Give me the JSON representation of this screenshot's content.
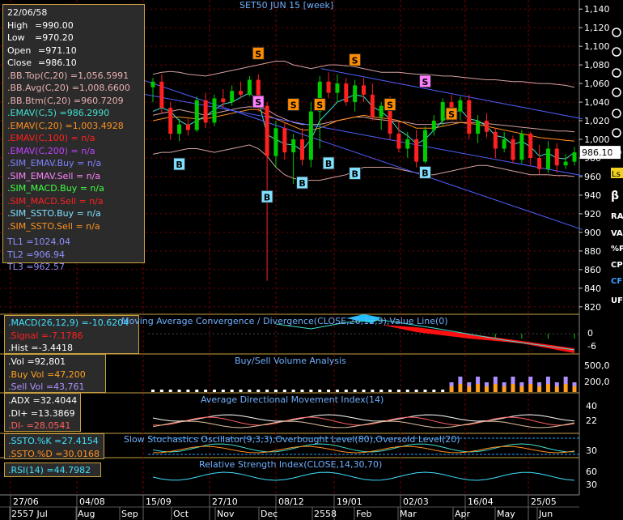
{
  "chart_data": {
    "type": "candlestick",
    "title": "SET50 JUN 15  [week]",
    "x_tick_labels": [
      "27/06",
      "04/08",
      "15/09",
      "27/10",
      "08/12",
      "19/01",
      "02/03",
      "16/04",
      "25/05"
    ],
    "month_labels": [
      "2557 Jul",
      "Aug",
      "Sep",
      "Oct",
      "Nov",
      "Dec",
      "2558",
      "Feb",
      "Mar",
      "Apr",
      "May",
      "Jun"
    ],
    "y_tick_labels": [
      "1,140",
      "1,120",
      "1,100",
      "1,080",
      "1,060",
      "1,040",
      "1,020",
      "1,000",
      "980",
      "960",
      "940",
      "920",
      "900",
      "880",
      "860",
      "840",
      "820"
    ],
    "y_range": [
      812,
      1148
    ],
    "last_price_label": "986.10",
    "candles": [
      {
        "o": 1056,
        "h": 1066,
        "l": 1040,
        "c": 1062
      },
      {
        "o": 1062,
        "h": 1070,
        "l": 1028,
        "c": 1034
      },
      {
        "o": 1034,
        "h": 1040,
        "l": 1000,
        "c": 1006
      },
      {
        "o": 1006,
        "h": 1022,
        "l": 998,
        "c": 1016
      },
      {
        "o": 1016,
        "h": 1022,
        "l": 1004,
        "c": 1010
      },
      {
        "o": 1010,
        "h": 1046,
        "l": 1008,
        "c": 1042
      },
      {
        "o": 1042,
        "h": 1050,
        "l": 1012,
        "c": 1018
      },
      {
        "o": 1018,
        "h": 1048,
        "l": 1014,
        "c": 1044
      },
      {
        "o": 1044,
        "h": 1054,
        "l": 1034,
        "c": 1040
      },
      {
        "o": 1040,
        "h": 1058,
        "l": 1036,
        "c": 1052
      },
      {
        "o": 1052,
        "h": 1062,
        "l": 1044,
        "c": 1048
      },
      {
        "o": 1048,
        "h": 1068,
        "l": 1046,
        "c": 1064
      },
      {
        "o": 1064,
        "h": 1070,
        "l": 1030,
        "c": 1036
      },
      {
        "o": 1036,
        "h": 1040,
        "l": 848,
        "c": 982
      },
      {
        "o": 982,
        "h": 1020,
        "l": 970,
        "c": 1012
      },
      {
        "o": 1012,
        "h": 1018,
        "l": 978,
        "c": 986
      },
      {
        "o": 986,
        "h": 1006,
        "l": 952,
        "c": 1000
      },
      {
        "o": 1000,
        "h": 1012,
        "l": 972,
        "c": 978
      },
      {
        "o": 978,
        "h": 1040,
        "l": 970,
        "c": 1030
      },
      {
        "o": 1030,
        "h": 1068,
        "l": 990,
        "c": 1062
      },
      {
        "o": 1062,
        "h": 1072,
        "l": 1044,
        "c": 1050
      },
      {
        "o": 1050,
        "h": 1070,
        "l": 1040,
        "c": 1060
      },
      {
        "o": 1060,
        "h": 1066,
        "l": 1036,
        "c": 1040
      },
      {
        "o": 1040,
        "h": 1064,
        "l": 1030,
        "c": 1058
      },
      {
        "o": 1058,
        "h": 1066,
        "l": 1040,
        "c": 1048
      },
      {
        "o": 1048,
        "h": 1060,
        "l": 1020,
        "c": 1024
      },
      {
        "o": 1024,
        "h": 1040,
        "l": 1010,
        "c": 1036
      },
      {
        "o": 1036,
        "h": 1046,
        "l": 1000,
        "c": 1006
      },
      {
        "o": 1006,
        "h": 1018,
        "l": 986,
        "c": 990
      },
      {
        "o": 990,
        "h": 1008,
        "l": 980,
        "c": 1000
      },
      {
        "o": 1000,
        "h": 1010,
        "l": 970,
        "c": 976
      },
      {
        "o": 976,
        "h": 1014,
        "l": 974,
        "c": 1010
      },
      {
        "o": 1010,
        "h": 1026,
        "l": 1004,
        "c": 1020
      },
      {
        "o": 1020,
        "h": 1044,
        "l": 1014,
        "c": 1040
      },
      {
        "o": 1040,
        "h": 1048,
        "l": 1026,
        "c": 1030
      },
      {
        "o": 1030,
        "h": 1046,
        "l": 1020,
        "c": 1042
      },
      {
        "o": 1042,
        "h": 1048,
        "l": 1000,
        "c": 1006
      },
      {
        "o": 1006,
        "h": 1026,
        "l": 996,
        "c": 1020
      },
      {
        "o": 1020,
        "h": 1028,
        "l": 1002,
        "c": 1008
      },
      {
        "o": 1008,
        "h": 1012,
        "l": 980,
        "c": 990
      },
      {
        "o": 990,
        "h": 1008,
        "l": 986,
        "c": 1000
      },
      {
        "o": 1000,
        "h": 1004,
        "l": 974,
        "c": 978
      },
      {
        "o": 978,
        "h": 1010,
        "l": 974,
        "c": 1006
      },
      {
        "o": 1006,
        "h": 1008,
        "l": 972,
        "c": 980
      },
      {
        "o": 980,
        "h": 994,
        "l": 962,
        "c": 968
      },
      {
        "o": 968,
        "h": 998,
        "l": 964,
        "c": 990
      },
      {
        "o": 990,
        "h": 996,
        "l": 964,
        "c": 972
      },
      {
        "o": 972,
        "h": 984,
        "l": 968,
        "c": 976
      },
      {
        "o": 976,
        "h": 992,
        "l": 972,
        "c": 986
      }
    ],
    "buy_signals": [
      {
        "i": 3,
        "v": 973
      },
      {
        "i": 13,
        "v": 938
      },
      {
        "i": 17,
        "v": 953
      },
      {
        "i": 20,
        "v": 974
      },
      {
        "i": 23,
        "v": 963
      },
      {
        "i": 31,
        "v": 964
      }
    ],
    "sell_signals": [
      {
        "i": 12,
        "v": 1092
      },
      {
        "i": 16,
        "v": 1037
      },
      {
        "i": 19,
        "v": 1037
      },
      {
        "i": 23,
        "v": 1085
      },
      {
        "i": 27,
        "v": 1037
      },
      {
        "i": 34,
        "v": 1027
      }
    ],
    "purple_sell_signals": [
      {
        "i": 12,
        "v": 1040
      },
      {
        "i": 31,
        "v": 1062
      }
    ],
    "trend_lines": [
      {
        "x1": 0,
        "y1": 1066,
        "x2": 48,
        "y2": 903
      },
      {
        "x1": 0,
        "y1": 1050,
        "x2": 48,
        "y2": 961
      },
      {
        "x1": 21,
        "y1": 1076,
        "x2": 48,
        "y2": 1022
      }
    ],
    "bb_top": [
      1070,
      1072,
      1073,
      1072,
      1070,
      1069,
      1068,
      1070,
      1072,
      1074,
      1076,
      1078,
      1080,
      1082,
      1084,
      1084,
      1080,
      1078,
      1076,
      1078,
      1080,
      1080,
      1079,
      1078,
      1076,
      1074,
      1072,
      1072,
      1072,
      1071,
      1070,
      1070,
      1069,
      1068,
      1068,
      1067,
      1066,
      1065,
      1064,
      1064,
      1063,
      1062,
      1062,
      1061,
      1060,
      1060,
      1059,
      1058,
      1056
    ],
    "bb_mid": [
      1026,
      1028,
      1030,
      1032,
      1030,
      1028,
      1026,
      1028,
      1030,
      1032,
      1034,
      1035,
      1034,
      1032,
      1026,
      1022,
      1018,
      1016,
      1016,
      1016,
      1018,
      1020,
      1022,
      1024,
      1024,
      1022,
      1021,
      1020,
      1019,
      1018,
      1016,
      1016,
      1016,
      1017,
      1018,
      1018,
      1018,
      1018,
      1017,
      1016,
      1015,
      1014,
      1013,
      1012,
      1011,
      1010,
      1009,
      1009,
      1008
    ],
    "bb_btm": [
      984,
      986,
      986,
      988,
      990,
      990,
      988,
      986,
      988,
      990,
      992,
      994,
      990,
      982,
      970,
      962,
      958,
      956,
      956,
      956,
      958,
      960,
      962,
      966,
      970,
      970,
      970,
      970,
      968,
      966,
      964,
      962,
      962,
      964,
      966,
      968,
      970,
      972,
      972,
      970,
      968,
      966,
      964,
      962,
      962,
      962,
      961,
      961,
      960
    ],
    "emav5": [
      1030,
      1034,
      1030,
      1020,
      1015,
      1020,
      1025,
      1032,
      1038,
      1040,
      1045,
      1050,
      1042,
      1005,
      1000,
      995,
      994,
      988,
      1000,
      1020,
      1030,
      1040,
      1044,
      1048,
      1046,
      1035,
      1030,
      1022,
      1010,
      1004,
      995,
      1000,
      1010,
      1020,
      1026,
      1032,
      1022,
      1020,
      1014,
      1004,
      1002,
      994,
      998,
      992,
      982,
      985,
      980,
      979,
      986
    ],
    "emav20": [
      1020,
      1022,
      1024,
      1024,
      1023,
      1022,
      1022,
      1024,
      1026,
      1028,
      1030,
      1032,
      1032,
      1026,
      1022,
      1018,
      1014,
      1010,
      1010,
      1012,
      1016,
      1020,
      1022,
      1024,
      1026,
      1024,
      1023,
      1022,
      1020,
      1016,
      1012,
      1012,
      1012,
      1014,
      1016,
      1018,
      1017,
      1016,
      1014,
      1012,
      1010,
      1008,
      1006,
      1004,
      1002,
      1001,
      1000,
      999,
      998
    ],
    "macd": {
      "label": "MACD(26,12,9)",
      "value": "-10.6204",
      "signal_label": "Signal",
      "signal": "-7.1786",
      "hist_label": "Hist",
      "hist": "-3.4418",
      "title": "Moving Average Convergence / Divergence(CLOSE,26,12,9),Value Line(0)",
      "y_ticks": [
        "0",
        "-6"
      ]
    },
    "volume": {
      "vol_label": "Vol",
      "vol": "92,801",
      "buy_label": "Buy Vol",
      "buy": "47,200",
      "sell_label": "Sell Vol",
      "sell": "43,761",
      "title": "Buy/Sell Volume Analysis",
      "y_ticks": [
        "500,0",
        "200,0"
      ]
    },
    "adx": {
      "adx_label": "ADX",
      "adx": "32.4044",
      "di_plus_label": "DI+",
      "di_plus": "13.3869",
      "di_minus_label": "DI-",
      "di_minus": "28.0541",
      "title": "Average Directional Movement Index(14)",
      "y_ticks": [
        "40",
        "22"
      ]
    },
    "ssto": {
      "k_label": "SSTO.%K",
      "k": "27.4154",
      "d_label": "SSTO.%D",
      "d": "30.0168",
      "title": "Slow Stochastics Oscillator(9,3,3),Overbought Level(80),Oversold Level(20)",
      "y_ticks": [
        "30"
      ]
    },
    "rsi": {
      "label": "RSI(14)",
      "value": "44.7982",
      "title": "Relative Strength Index(CLOSE,14,30,70)",
      "y_ticks": [
        "60",
        "30"
      ]
    }
  },
  "info": {
    "date": "22/06/58",
    "high_label": "High",
    "high": "=990.00",
    "low_label": "Low",
    "low": "=970.20",
    "open_label": "Open",
    "open": "=971.10",
    "close_label": "Close",
    "close": "=986.10",
    "bb_top": ".BB.Top(C,20)  =1,056.5991",
    "bb_avg": ".BB.Avg(C,20)  =1,008.6600",
    "bb_btm": ".BB.Btm(C,20)  =960.7209",
    "emav5": ".EMAV(C,5)  =986.2990",
    "emav20": ".EMAV(C,20)  =1,003.4928",
    "emav100": ".EMAV(C,100)  = n/a",
    "emav200": ".EMAV(C,200)  = n/a",
    "sim_emav_buy": ".SIM_EMAV.Buy  = n/a",
    "sim_emav_sell": ".SIM_EMAV.Sell  = n/a",
    "sim_macd_buy": ".SIM_MACD.Buy  = n/a",
    "sim_macd_sell": ".SIM_MACD.Sell  = n/a",
    "sim_ssto_buy": ".SIM_SSTO.Buy  = n/a",
    "sim_ssto_sell": ".SIM_SSTO.Sell  = n/a",
    "tl1": "TL1 =1024.04",
    "tl2": "TL2 =906.94",
    "tl3": "TL3 =962.57"
  },
  "colors": {
    "up": "#00cc00",
    "down": "#ff2020",
    "bb": "#d4a0a0",
    "emav5": "#40e0d0",
    "emav20": "#ff9020",
    "trend": "#5060ff",
    "sell": "#ff8c00",
    "buy": "#80e0ff",
    "purple_sell": "#ff80ff",
    "grid": "#7a0000"
  },
  "side_tools": [
    "β",
    "RA",
    "VA",
    "%P",
    "CP",
    "CF",
    "UF"
  ]
}
